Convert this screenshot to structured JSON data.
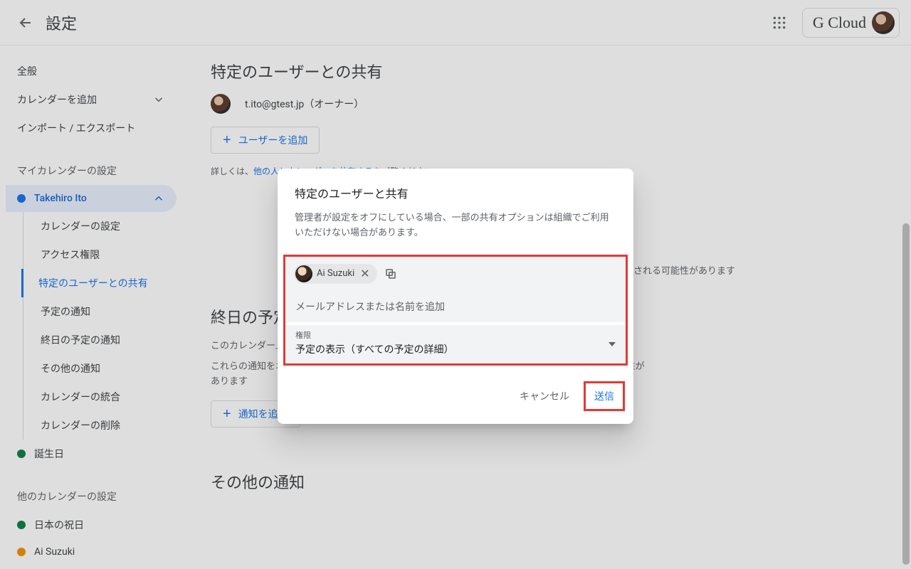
{
  "header": {
    "title": "設定",
    "account_label": "G Cloud"
  },
  "sidebar": {
    "general": "全般",
    "add_calendar": "カレンダーを追加",
    "import_export": "インポート / エクスポート",
    "my_cal_heading": "マイカレンダーの設定",
    "active_cal": "Takehiro Ito",
    "sub": {
      "cal_settings": "カレンダーの設定",
      "access": "アクセス権限",
      "share_specific": "特定のユーザーとの共有",
      "event_notif": "予定の通知",
      "allday_notif": "終日の予定の通知",
      "other_notif": "その他の通知",
      "integrate": "カレンダーの統合",
      "delete": "カレンダーの削除"
    },
    "birthdays": "誕生日",
    "other_cal_heading": "他のカレンダーの設定",
    "jp_holidays": "日本の祝日",
    "ai_suzuki": "Ai Suzuki",
    "colors": {
      "active": "#1a73e8",
      "birthdays": "#0b8043",
      "jp": "#0b8043",
      "ai": "#f09300"
    }
  },
  "main": {
    "share_title": "特定のユーザーとの共有",
    "owner_email": "t.ito@gtest.jp（オーナー）",
    "add_user_btn": "ユーザーを追加",
    "help_prefix": "詳しくは、",
    "help_link": "他の人とカレンダーを共有する",
    "help_suffix": "をご覧ください",
    "warn_tail": "される可能性があります",
    "allday_title": "終日の予定の通知",
    "allday_desc1": "このカレンダー上の終日の予定に関する通知が届きます。",
    "allday_desc2": "これらの通知をオプトインすると、カレンダーのオーナーにアラートが届き、通知が表示される可能性があります",
    "add_notif_btn": "通知を追加",
    "other_notif_title": "その他の通知"
  },
  "dialog": {
    "title": "特定のユーザーと共有",
    "note": "管理者が設定をオフにしている場合、一部の共有オプションは組織でご利用いただけない場合があります。",
    "chip_name": "Ai Suzuki",
    "input_placeholder": "メールアドレスまたは名前を追加",
    "perm_label": "権限",
    "perm_value": "予定の表示（すべての予定の詳細）",
    "cancel": "キャンセル",
    "send": "送信"
  }
}
